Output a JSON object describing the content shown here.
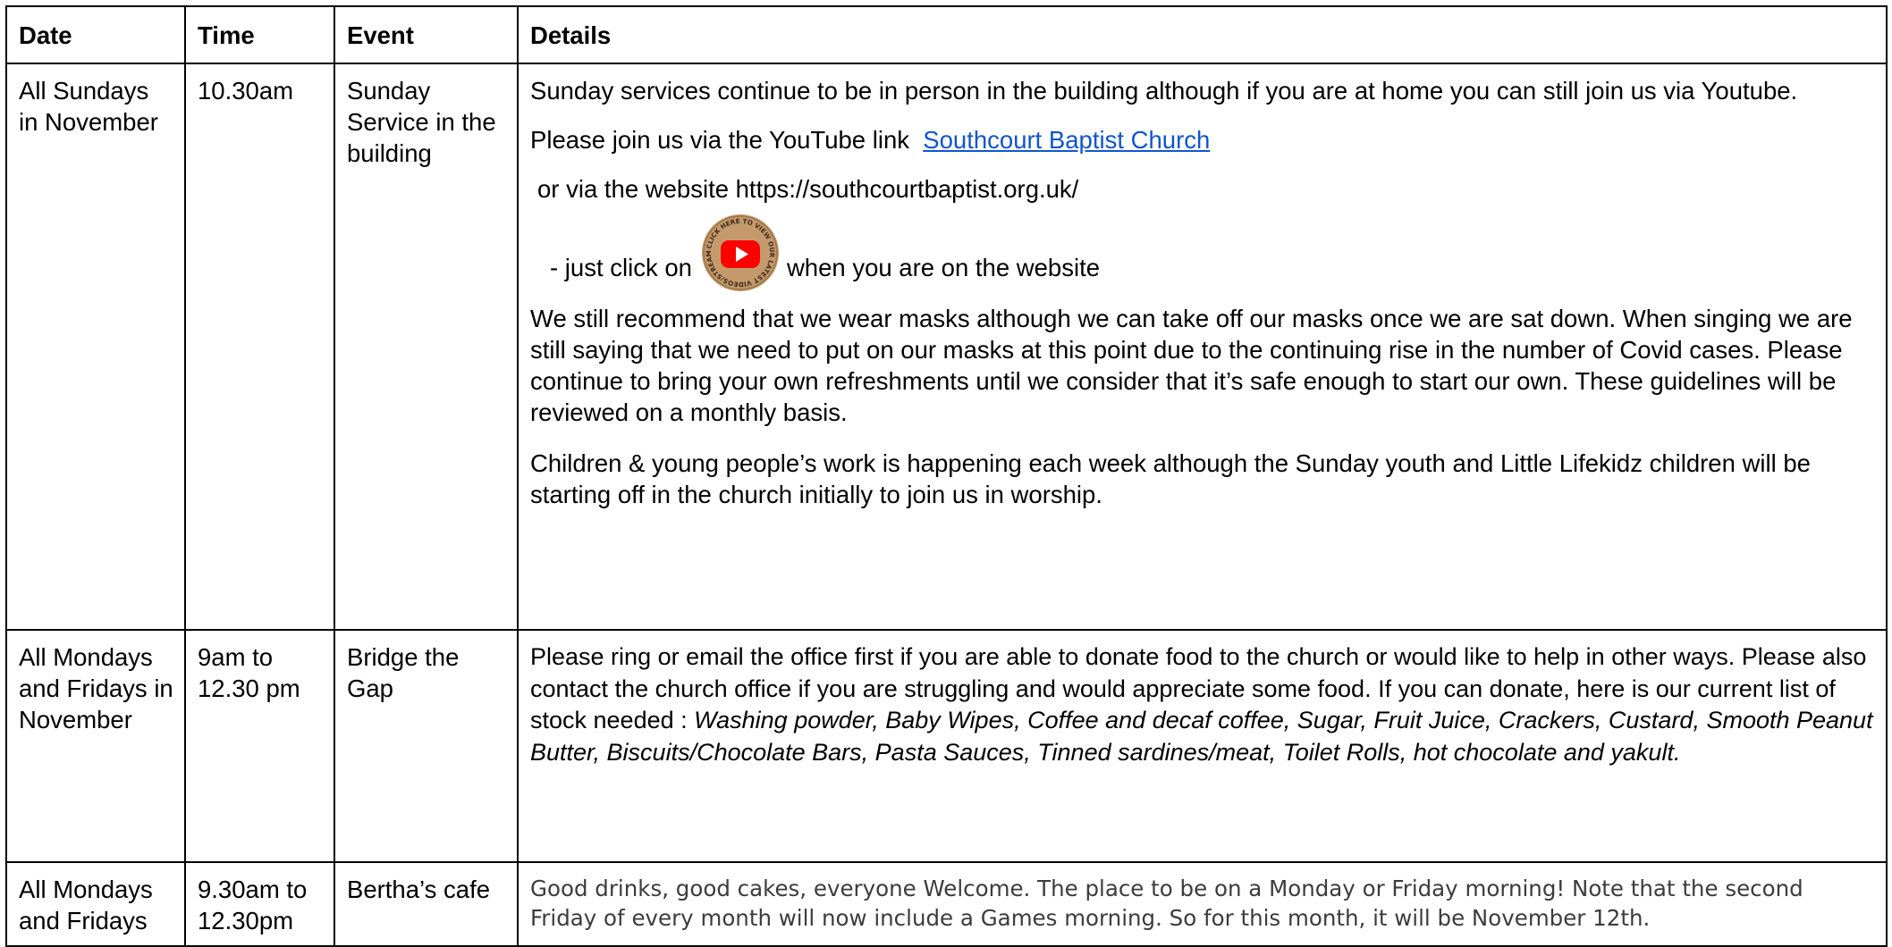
{
  "headers": {
    "date": "Date",
    "time": "Time",
    "event": "Event",
    "details": "Details"
  },
  "rows": [
    {
      "date": "All Sundays in November",
      "time": "10.30am",
      "event": "Sunday Service in the building",
      "p1": "Sunday services continue to be in person in the building although if you are at home you can still join us via Youtube.",
      "p2_prefix": "Please join us via the YouTube link",
      "p2_link": "Southcourt Baptist Church",
      "p3": "or via the website https://southcourtbaptist.org.uk/",
      "p4_before": "- just click on",
      "p4_after": "when you are on the website",
      "badge_text": "CLICK HERE TO VIEW OUR LATEST VIDEOS/STREAMS",
      "p5": "We still recommend that we wear masks although we can take off our masks once we are sat down. When singing we are still saying that we need to put on our masks at this point due to the continuing rise in the number of Covid cases. Please continue to bring your own refreshments until we consider that it’s safe enough to start our own. These guidelines will be reviewed on a monthly basis.",
      "p6": "Children & young people’s work is happening each week although the Sunday youth and Little Lifekidz children will be starting off in the church initially to join us in worship."
    },
    {
      "date": "All Mondays and Fridays in November",
      "time": "9am to 12.30 pm",
      "event": "Bridge the Gap",
      "intro": "Please ring or email the office first if you are able to donate food to the church or would like to help in other ways. Please also contact the church office if you are struggling and would appreciate some food. If you can donate, here is our current list of stock needed :",
      "items": "Washing powder, Baby Wipes, Coffee and decaf coffee, Sugar, Fruit Juice, Crackers, Custard, Smooth Peanut Butter, Biscuits/Chocolate Bars, Pasta Sauces, Tinned sardines/meat, Toilet Rolls, hot chocolate and yakult."
    },
    {
      "date": "All Mondays and Fridays",
      "time": "9.30am to 12.30pm",
      "event": "Bertha’s cafe",
      "details": "Good drinks, good cakes, everyone Welcome. The place to be on a Monday or Friday morning! Note that the second Friday of every month will now include a Games morning. So for this month, it will be November 12th."
    }
  ],
  "colors": {
    "link": "#1155cc",
    "youtube_red": "#ff0000",
    "badge": "#c49a6c",
    "muted_text": "#3c3c3c"
  },
  "icons": {
    "badge": "youtube-play-icon"
  }
}
